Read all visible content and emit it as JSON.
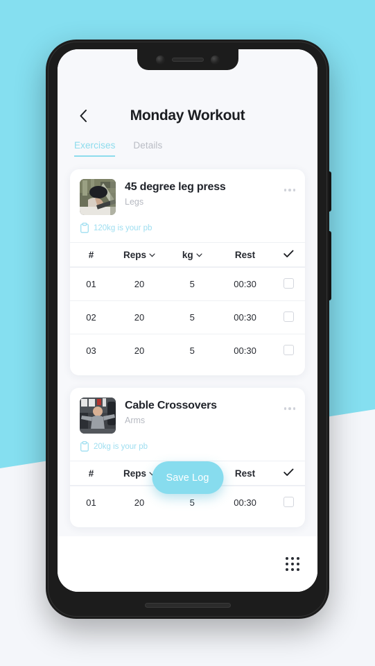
{
  "background": {
    "accent_color": "#85dff0",
    "base_color": "#f4f6fa"
  },
  "device": {
    "frame_color": "#1c1c1c",
    "screen_bg": "#f7f8fb"
  },
  "header": {
    "back_icon": "chevron-left-icon",
    "title": "Monday Workout"
  },
  "tabs": [
    {
      "label": "Exercises",
      "active": true
    },
    {
      "label": "Details",
      "active": false
    }
  ],
  "theme": {
    "accent": "#87dcee",
    "text_primary": "#20232a",
    "text_muted": "#b6b9c1"
  },
  "table_columns": [
    {
      "label": "#",
      "has_caret": false
    },
    {
      "label": "Reps",
      "has_caret": true
    },
    {
      "label": "kg",
      "has_caret": true
    },
    {
      "label": "Rest",
      "has_caret": false
    },
    {
      "label": "check-icon",
      "has_caret": false
    }
  ],
  "exercises": [
    {
      "name": "45 degree leg press",
      "muscle_group": "Legs",
      "pb_icon": "clipboard-icon",
      "pb_text": "120kg is your pb",
      "more_icon": "more-horizontal-icon",
      "thumbnail": "leg-press-photo",
      "sets": [
        {
          "index": "01",
          "reps": "20",
          "kg": "5",
          "rest": "00:30",
          "done": false
        },
        {
          "index": "02",
          "reps": "20",
          "kg": "5",
          "rest": "00:30",
          "done": false
        },
        {
          "index": "03",
          "reps": "20",
          "kg": "5",
          "rest": "00:30",
          "done": false
        }
      ]
    },
    {
      "name": "Cable Crossovers",
      "muscle_group": "Arms",
      "pb_icon": "clipboard-icon",
      "pb_text": "20kg is your pb",
      "more_icon": "more-horizontal-icon",
      "thumbnail": "cable-crossover-photo",
      "sets": [
        {
          "index": "01",
          "reps": "20",
          "kg": "5",
          "rest": "00:30",
          "done": false
        }
      ]
    }
  ],
  "save_log": {
    "label": "Save Log"
  },
  "bottom_bar": {
    "grid_icon": "grid-dots-icon"
  }
}
